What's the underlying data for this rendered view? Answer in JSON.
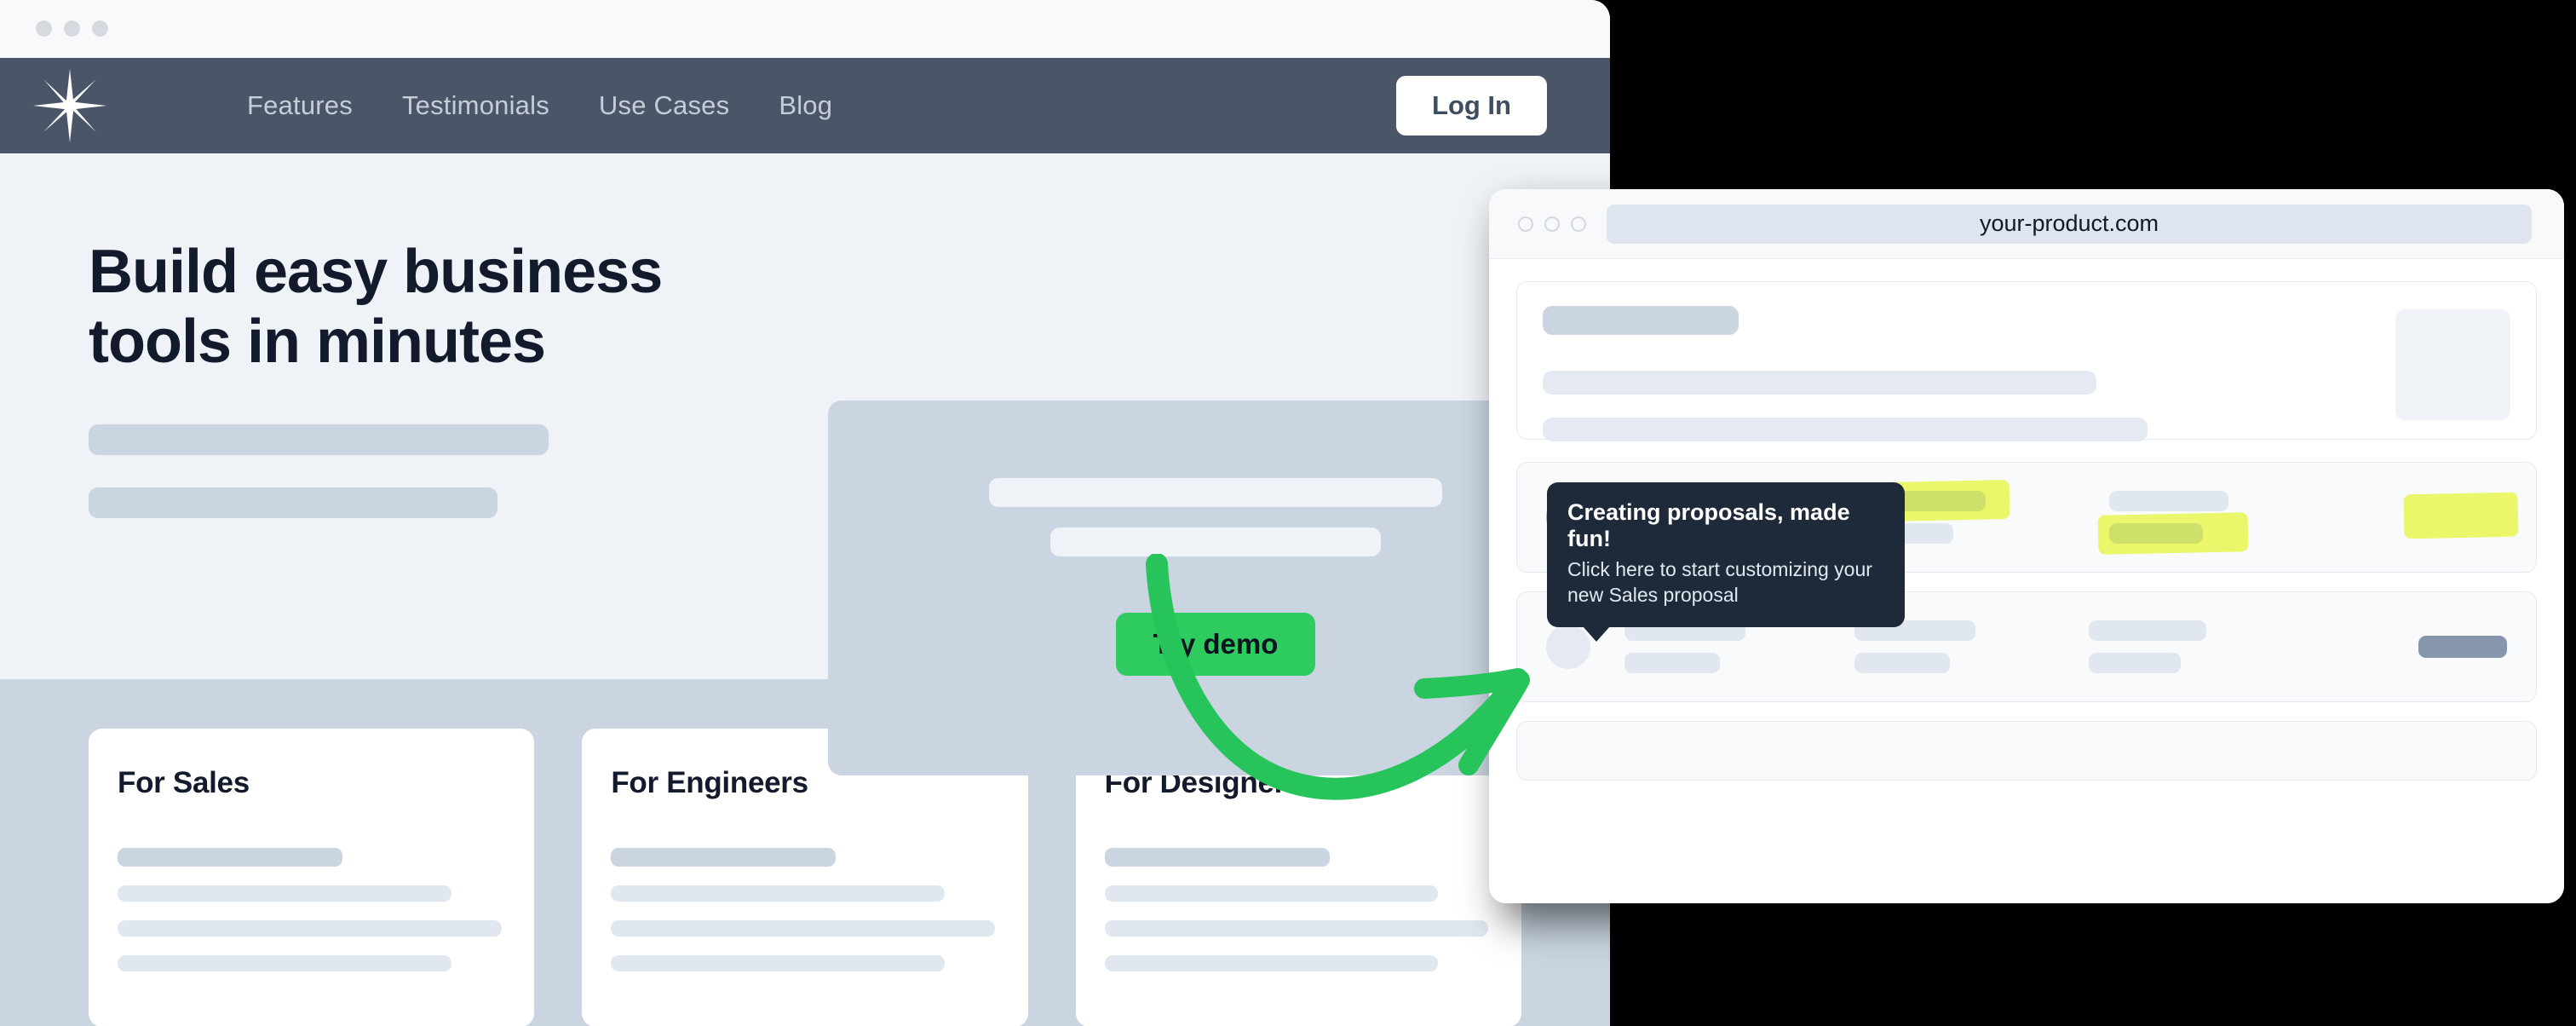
{
  "window_back": {
    "traffic_lights": [
      "close-dot",
      "minimize-dot",
      "maximize-dot"
    ],
    "logo": "asterisk-starburst-logo",
    "nav": [
      {
        "label": "Features"
      },
      {
        "label": "Testimonials"
      },
      {
        "label": "Use Cases"
      },
      {
        "label": "Blog"
      }
    ],
    "login_label": "Log In",
    "hero": {
      "headline": "Build easy business tools in minutes",
      "cta_label": "Try demo"
    },
    "cards": [
      {
        "title": "For Sales"
      },
      {
        "title": "For Engineers"
      },
      {
        "title": "For Designers"
      }
    ]
  },
  "window_front": {
    "traffic_lights": [
      "close-dot",
      "minimize-dot",
      "maximize-dot"
    ],
    "url": "your-product.com",
    "tooltip": {
      "title": "Creating proposals, made fun!",
      "body": "Click here to start customizing your new Sales proposal"
    },
    "rows": [
      {
        "name": "highlighted-proposal-row",
        "icon": "target-radio-icon",
        "highlighted": true
      },
      {
        "name": "secondary-row",
        "icon": "avatar-circle-icon",
        "highlighted": false
      }
    ]
  },
  "annotation": {
    "arrow": "curved-green-arrow"
  },
  "colors": {
    "navbar": "#4A5568",
    "hero_bg": "#EFF3F8",
    "band": "#CBD5E1",
    "headline": "#121A2B",
    "cta_green": "#2ECC5E",
    "arrow_green": "#27C45C",
    "tooltip_bg": "#1E2A3A",
    "highlight_yellow": "#EAF76A",
    "placeholder_light": "#E1E7EF",
    "placeholder_dark": "#CBD5E1",
    "page_backdrop": "#000000"
  }
}
